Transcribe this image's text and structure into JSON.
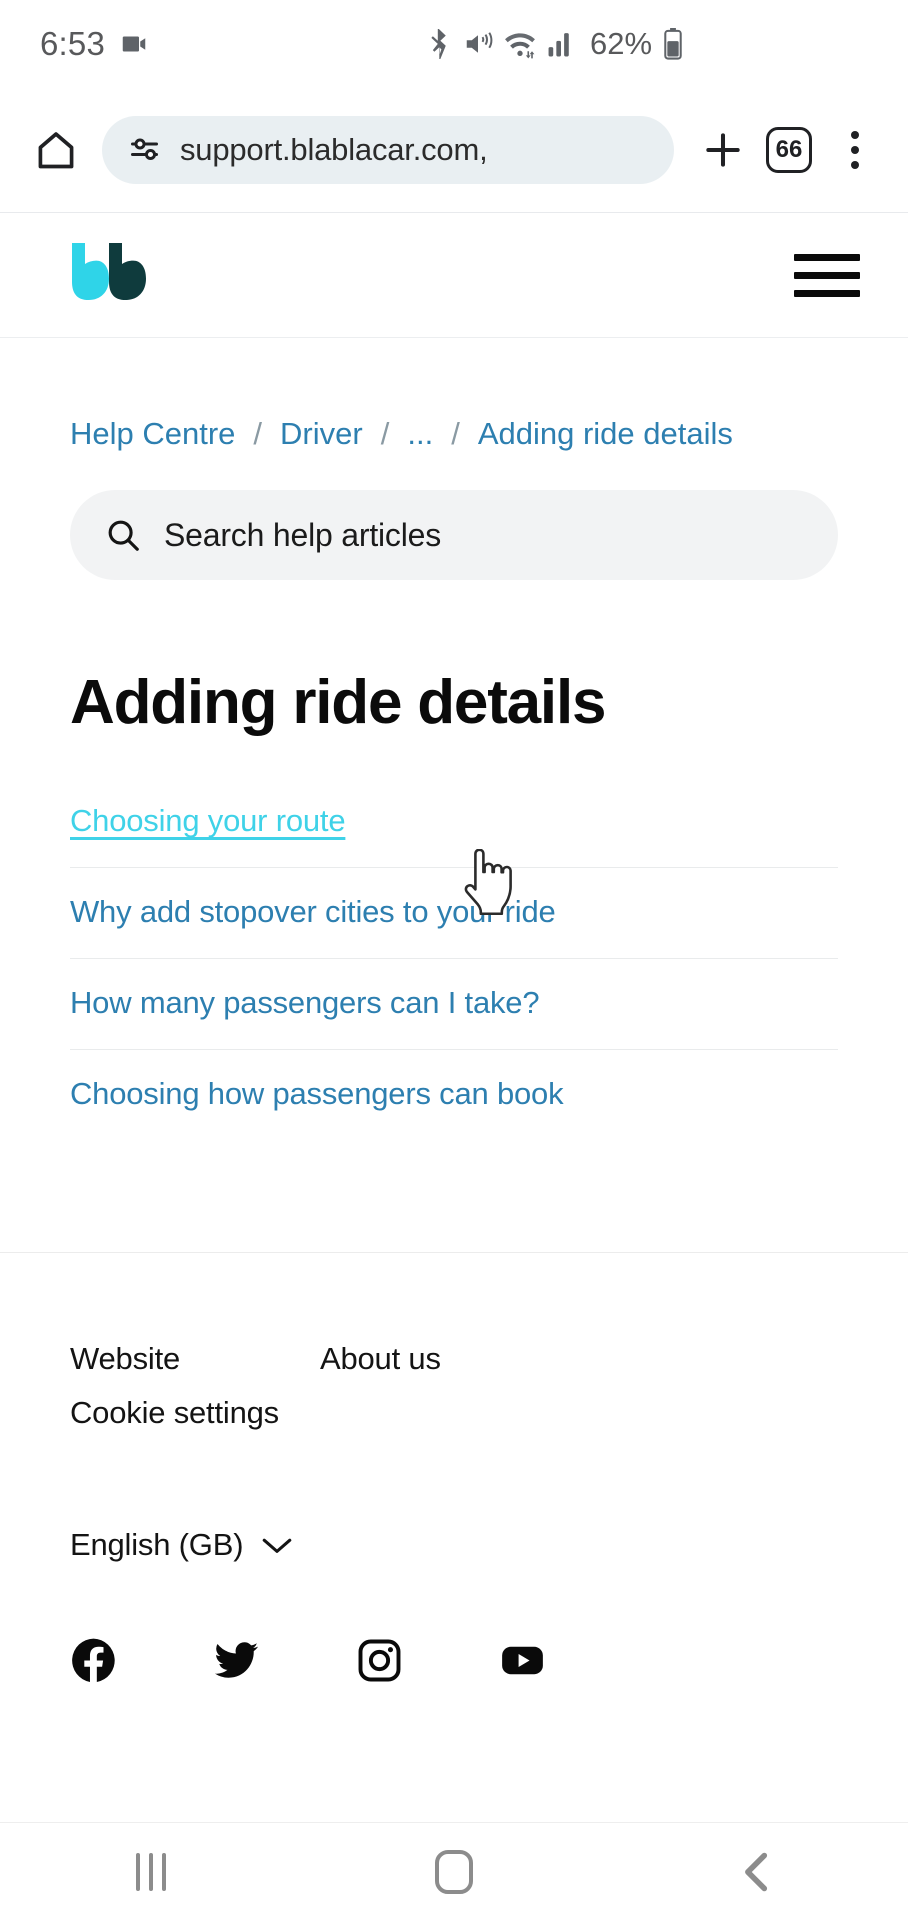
{
  "status_bar": {
    "time": "6:53",
    "battery_percent": "62%",
    "icons": [
      "video-recording-icon",
      "bluetooth-icon",
      "mute-vibrate-icon",
      "wifi-icon",
      "cellular-signal-icon",
      "battery-icon"
    ]
  },
  "browser": {
    "url": "support.blablacar.com,",
    "tab_count": "66",
    "home_label": "home-icon",
    "new_tab_label": "new-tab-icon",
    "menu_label": "more-options-icon"
  },
  "site_header": {
    "logo_alt": "BlaBlaCar",
    "menu_label": "Menu"
  },
  "breadcrumb": {
    "items": [
      {
        "label": "Help Centre"
      },
      {
        "label": "Driver"
      },
      {
        "label": "..."
      },
      {
        "label": "Adding ride details"
      }
    ],
    "separator": "/"
  },
  "search": {
    "placeholder": "Search help articles",
    "value": ""
  },
  "page": {
    "title": "Adding ride details"
  },
  "articles": [
    {
      "label": "Choosing your route",
      "hovered": true
    },
    {
      "label": "Why add stopover cities to your ride",
      "hovered": false
    },
    {
      "label": "How many passengers can I take?",
      "hovered": false
    },
    {
      "label": "Choosing how passengers can book",
      "hovered": false
    }
  ],
  "footer": {
    "links": [
      {
        "label": "Website"
      },
      {
        "label": "About us"
      },
      {
        "label": "Cookie settings"
      }
    ],
    "language": "English (GB)",
    "social": [
      {
        "name": "facebook"
      },
      {
        "name": "twitter"
      },
      {
        "name": "instagram"
      },
      {
        "name": "youtube"
      }
    ]
  },
  "nav_bar": {
    "recents": "recents-button",
    "home": "home-button",
    "back": "back-button"
  },
  "colors": {
    "link": "#2d7fb0",
    "link_hover": "#3fd2e8",
    "logo_cyan": "#2fd4e8",
    "logo_dark": "#0f3b3d",
    "logo_green": "#9ae84f",
    "url_bar_bg": "#e9eff2",
    "search_bg": "#f2f3f4"
  }
}
